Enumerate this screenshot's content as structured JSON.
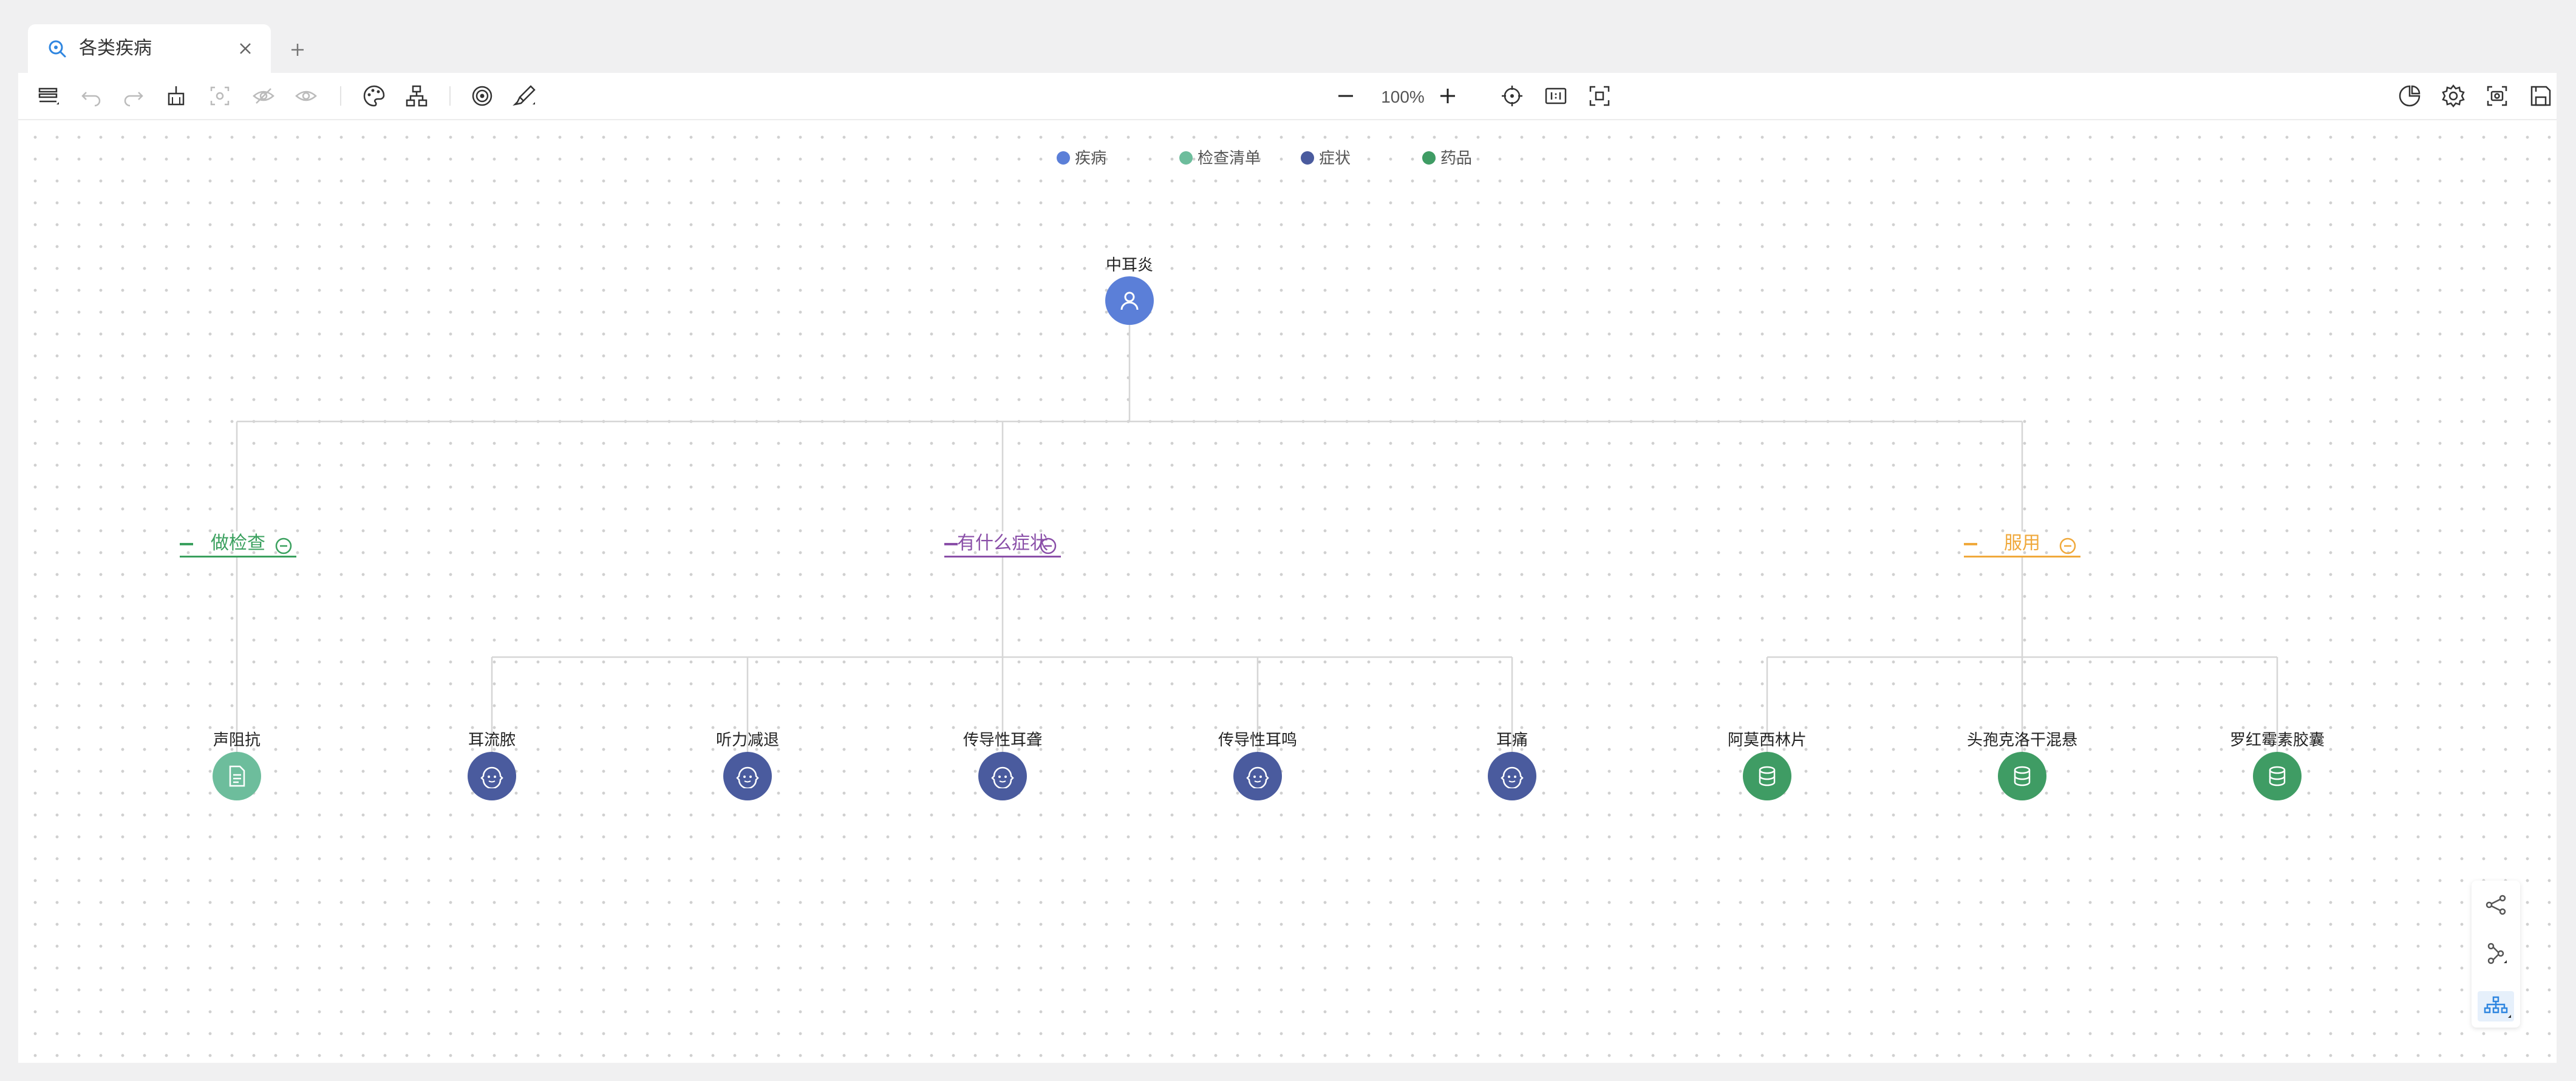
{
  "tab": {
    "title": "各类疾病",
    "new_tab": "+"
  },
  "toolbar": {
    "zoom": "100%"
  },
  "legend": [
    {
      "label": "疾病",
      "color": "#5b7fd8"
    },
    {
      "label": "检查清单",
      "color": "#6dbd9c"
    },
    {
      "label": "症状",
      "color": "#4a5b9e"
    },
    {
      "label": "药品",
      "color": "#3f9c64"
    }
  ],
  "root": {
    "label": "中耳炎",
    "color": "#5b7fd8"
  },
  "branches": [
    {
      "label": "做检查",
      "color": "#3aa05e"
    },
    {
      "label": "有什么症状",
      "color": "#8a4fa8"
    },
    {
      "label": "服用",
      "color": "#f0a93c"
    }
  ],
  "leaves": [
    {
      "label": "声阻抗",
      "type": "检查清单",
      "color": "#6dbd9c",
      "icon": "document-icon"
    },
    {
      "label": "耳流脓",
      "type": "症状",
      "color": "#4a5b9e",
      "icon": "face-icon"
    },
    {
      "label": "听力减退",
      "type": "症状",
      "color": "#4a5b9e",
      "icon": "face-icon"
    },
    {
      "label": "传导性耳聋",
      "type": "症状",
      "color": "#4a5b9e",
      "icon": "face-icon"
    },
    {
      "label": "传导性耳鸣",
      "type": "症状",
      "color": "#4a5b9e",
      "icon": "face-icon"
    },
    {
      "label": "耳痛",
      "type": "症状",
      "color": "#4a5b9e",
      "icon": "face-icon"
    },
    {
      "label": "阿莫西林片",
      "type": "药品",
      "color": "#3f9c64",
      "icon": "database-icon"
    },
    {
      "label": "头孢克洛干混悬",
      "type": "药品",
      "color": "#3f9c64",
      "icon": "database-icon"
    },
    {
      "label": "罗红霉素胶囊",
      "type": "药品",
      "color": "#3f9c64",
      "icon": "database-icon"
    }
  ]
}
